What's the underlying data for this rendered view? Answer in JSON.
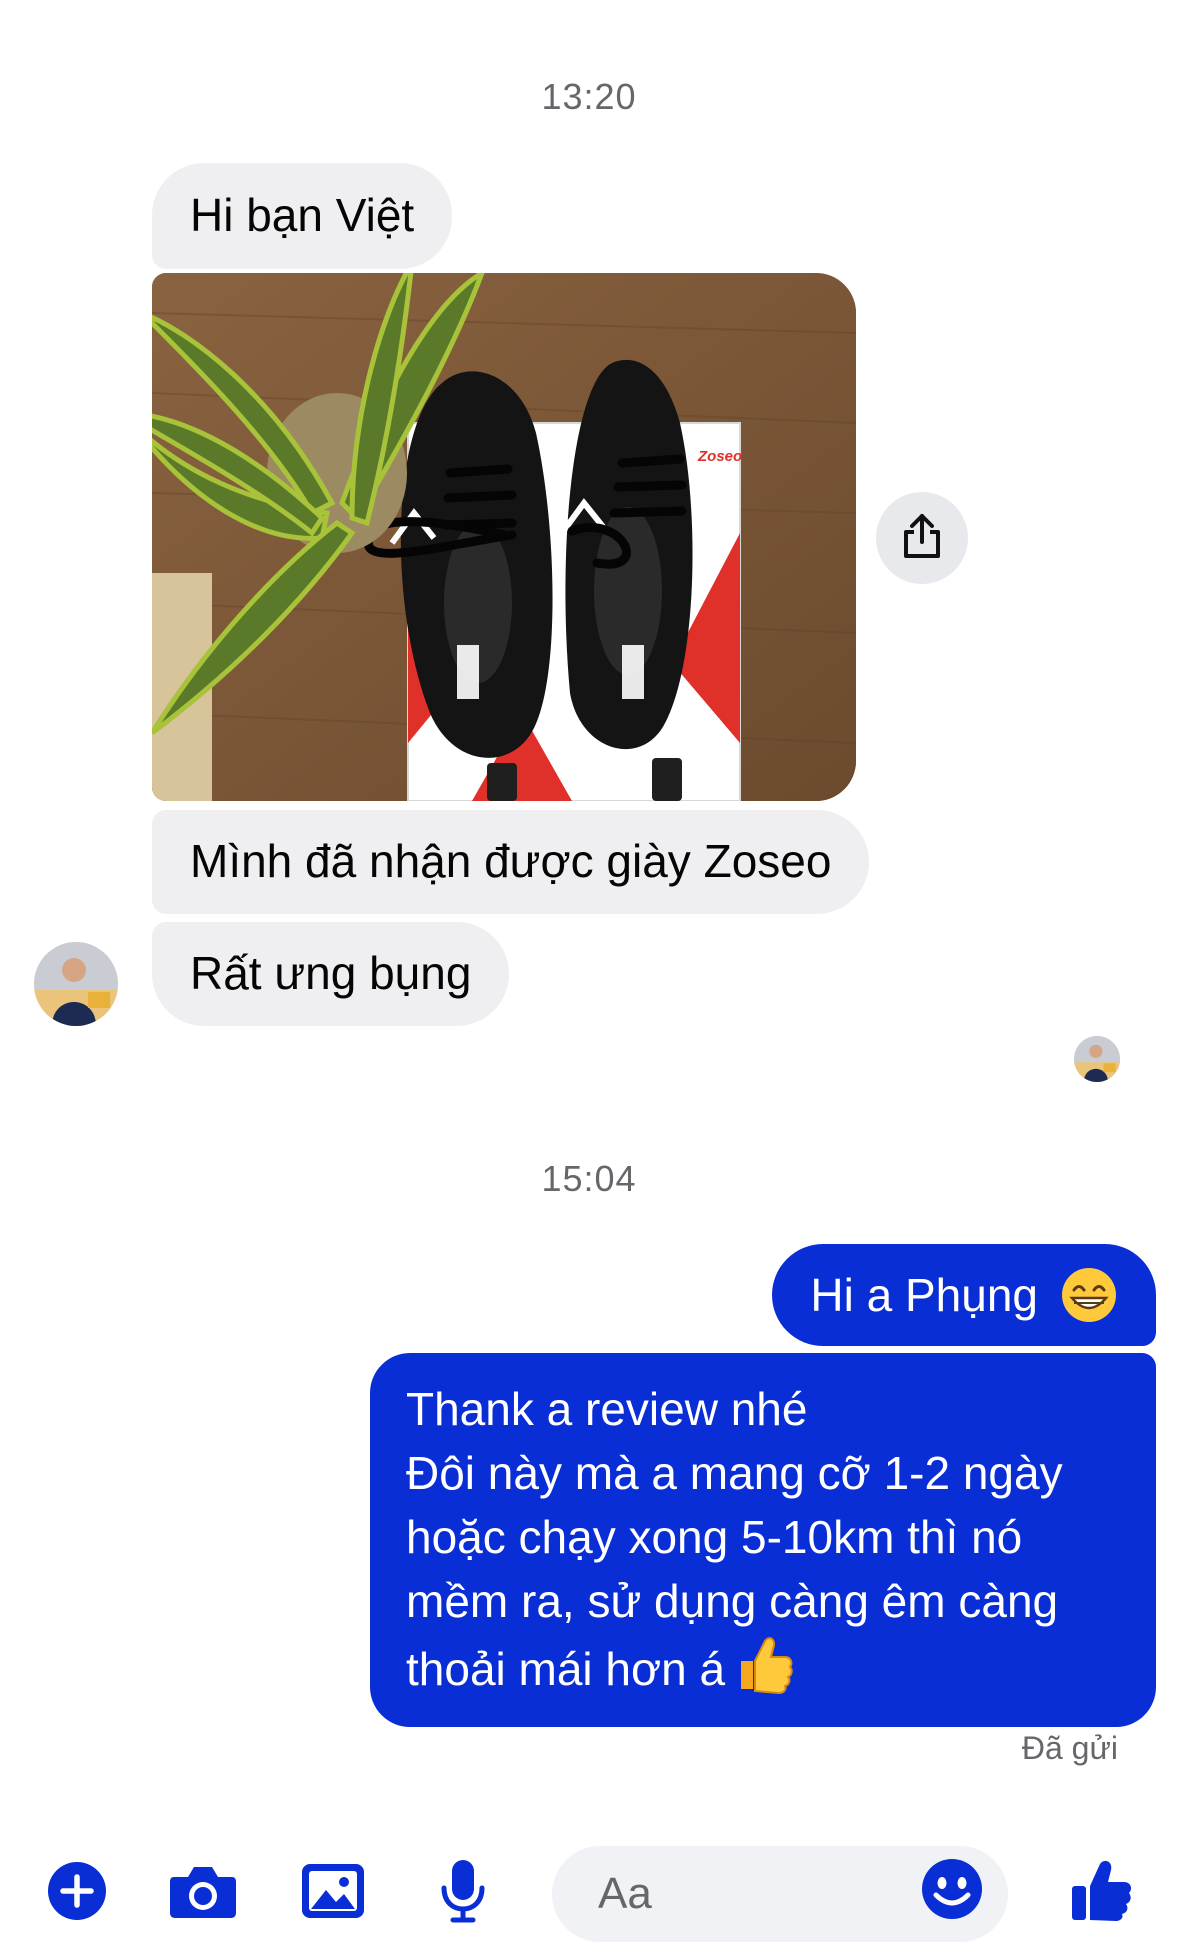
{
  "conversation": {
    "timestamp_1": "13:20",
    "timestamp_2": "15:04",
    "incoming": {
      "msg_1": "Hi bạn Việt",
      "msg_2": "Mình đã nhận được giày Zoseo",
      "msg_3": "Rất ưng bụng",
      "photo_brand_text": "Zoseo"
    },
    "outgoing": {
      "msg_1": "Hi a Phụng",
      "msg_2_lines": [
        "Thank a review nhé",
        "Đôi này mà a mang cỡ 1-2 ngày",
        "hoặc chạy xong 5-10km thì nó",
        "mềm ra, sử dụng càng êm càng",
        "thoải mái hơn á"
      ],
      "status": "Đã gửi"
    }
  },
  "composer": {
    "placeholder": "Aa",
    "icons": [
      "plus-icon",
      "camera-icon",
      "image-icon",
      "microphone-icon",
      "emoji-icon",
      "like-icon"
    ]
  },
  "colors": {
    "outgoing_bubble": "#0a2ed6",
    "incoming_bubble": "#efeff1",
    "accent": "#0a2ed6",
    "secondary_text": "#65676b"
  }
}
